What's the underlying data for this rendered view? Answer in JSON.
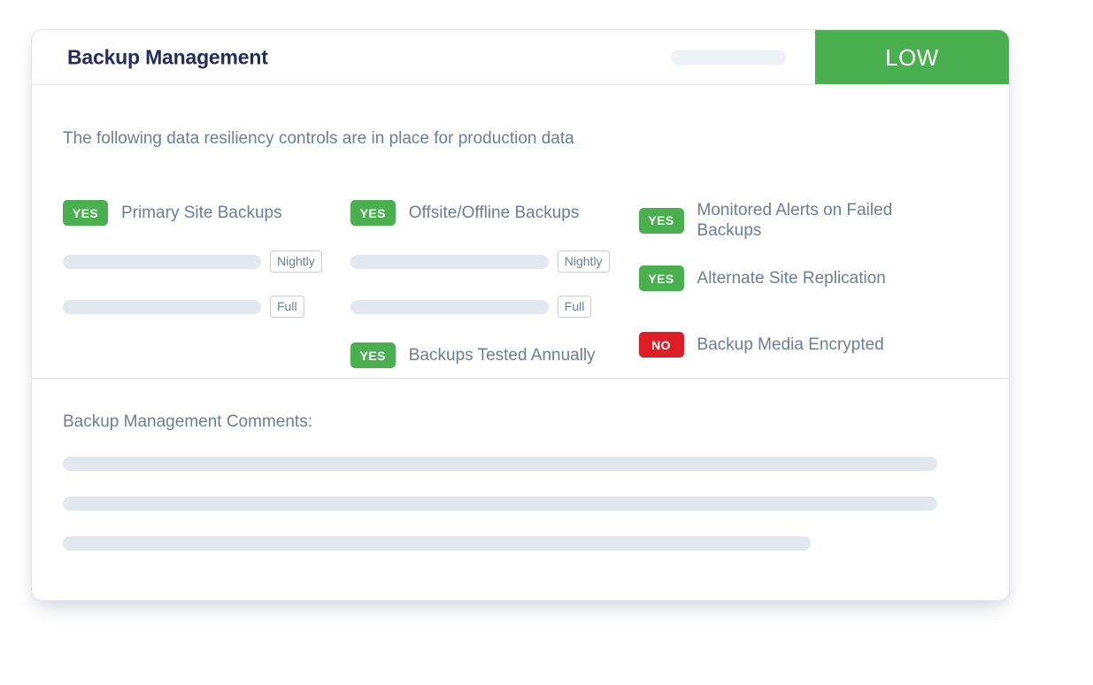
{
  "card": {
    "header": {
      "title": "Backup Management",
      "severity_label": "LOW",
      "severity_color": "#4aaf4f",
      "placeholder_pill": ""
    },
    "body": {
      "intro": "The following data resiliency controls are in place for production data",
      "columns": [
        {
          "name": "column-primary",
          "controls": [
            {
              "status": "YES",
              "label": "Primary Site Backups"
            }
          ],
          "value_rows": [
            {
              "placeholder": "",
              "tag": "Nightly"
            },
            {
              "placeholder": "",
              "tag": "Full"
            }
          ]
        },
        {
          "name": "column-offsite",
          "controls": [
            {
              "status": "YES",
              "label": "Offsite/Offline Backups"
            },
            {
              "status": "YES",
              "label": "Backups Tested Annually"
            }
          ],
          "value_rows": [
            {
              "placeholder": "",
              "tag": "Nightly"
            },
            {
              "placeholder": "",
              "tag": "Full"
            }
          ]
        },
        {
          "name": "column-monitoring",
          "controls": [
            {
              "status": "YES",
              "label": "Monitored Alerts on Failed Backups"
            },
            {
              "status": "YES",
              "label": "Alternate Site Replication"
            },
            {
              "status": "NO",
              "label": "Backup Media Encrypted"
            }
          ],
          "value_rows": []
        }
      ],
      "status_colors": {
        "yes": "#4aaf4f",
        "no": "#de1d25"
      }
    },
    "comments": {
      "label": "Backup Management Comments:",
      "lines": [
        "",
        "",
        ""
      ]
    }
  }
}
